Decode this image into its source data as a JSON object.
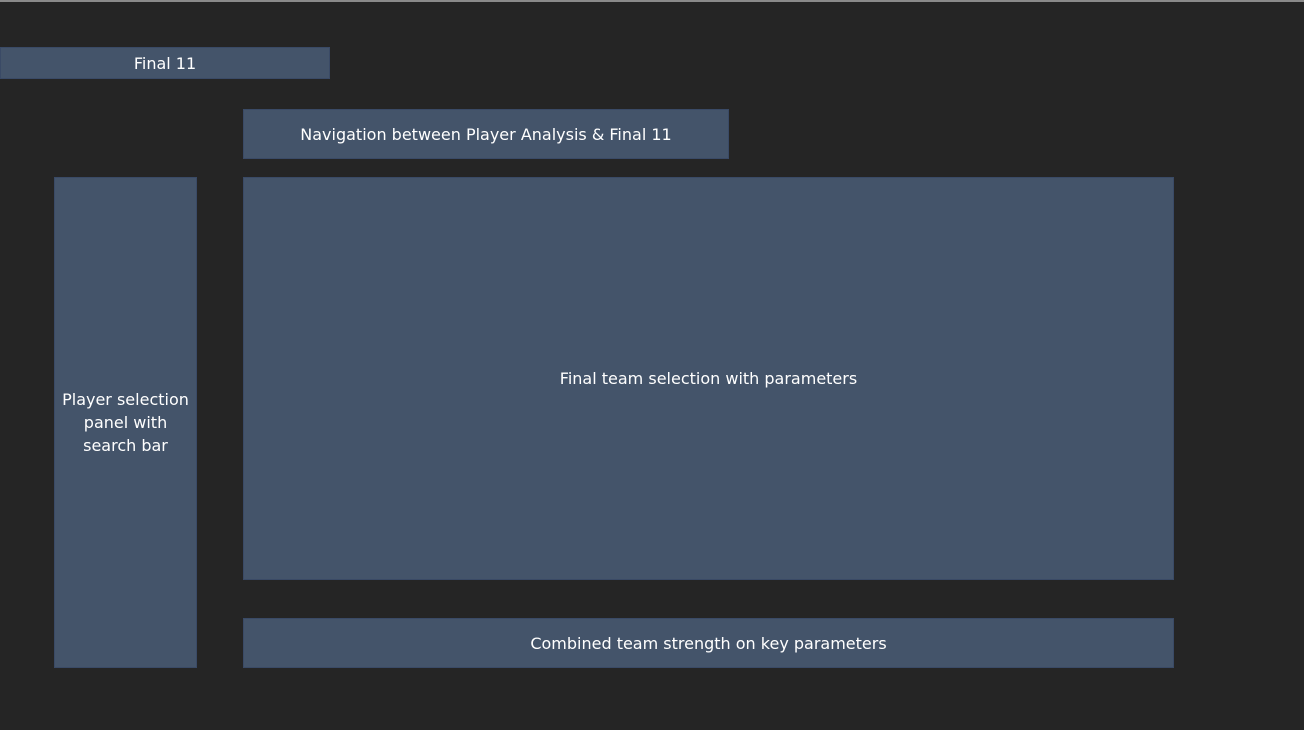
{
  "title_box": {
    "label": "Final 11"
  },
  "navigation_box": {
    "label": "Navigation between Player Analysis & Final 11"
  },
  "player_panel_box": {
    "label": "Player selection panel with search bar"
  },
  "team_selection_box": {
    "label": "Final team selection with parameters"
  },
  "team_strength_box": {
    "label": "Combined team strength on key parameters"
  },
  "colors": {
    "background": "#252525",
    "box_fill": "#44546a",
    "box_border": "#3a4a66",
    "text": "#ffffff"
  }
}
